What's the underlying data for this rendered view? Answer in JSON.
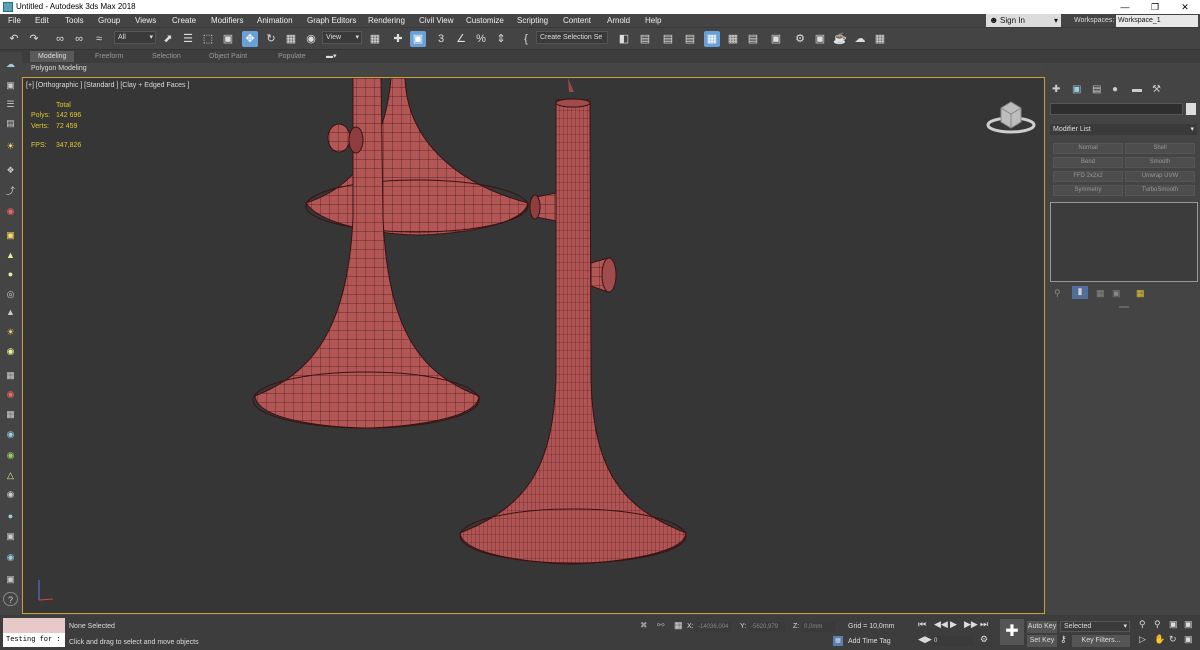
{
  "window": {
    "title": "Untitled - Autodesk 3ds Max 2018"
  },
  "menu": [
    "File",
    "Edit",
    "Tools",
    "Group",
    "Views",
    "Create",
    "Modifiers",
    "Animation",
    "Graph Editors",
    "Rendering",
    "Civil View",
    "Customize",
    "Scripting",
    "Content",
    "Arnold",
    "Help"
  ],
  "account": {
    "signin": "Sign In",
    "workspaces_label": "Workspaces:",
    "workspace": "Workspace_1"
  },
  "toolbar": {
    "filter": "All",
    "ref_coord": "View",
    "selection_set": "Create Selection Se"
  },
  "ribbon": {
    "tabs": [
      "Modeling",
      "Freeform",
      "Selection",
      "Object Paint",
      "Populate"
    ],
    "active": "Modeling",
    "panel": "Polygon Modeling"
  },
  "viewport": {
    "label": "[+] [Orthographic ] [Standard ] [Clay + Edged Faces ]",
    "stats": {
      "total_label": "Total",
      "polys_label": "Polys:",
      "polys": "142 696",
      "verts_label": "Verts:",
      "verts": "72 459",
      "fps_label": "FPS:",
      "fps": "347,826"
    },
    "object_color": "#b25656"
  },
  "command_panel": {
    "modifier_list": "Modifier List",
    "modifiers": [
      "Normal",
      "Shell",
      "Bend",
      "Smooth",
      "FFD 2x2x2",
      "Unwrap UVW",
      "Symmetry",
      "TurboSmooth"
    ]
  },
  "status": {
    "maxscript_output": "Testing for :",
    "selection": "None Selected",
    "prompt": "Click and drag to select and move objects",
    "x_label": "X:",
    "x": "-14036,004",
    "y_label": "Y:",
    "y": "-5620,979",
    "z_label": "Z:",
    "z": "0,0mm",
    "grid": "Grid = 10,0mm",
    "add_time_tag": "Add Time Tag",
    "frame": "0",
    "auto_key": "Auto Key",
    "set_key": "Set Key",
    "key_mode": "Selected",
    "key_filters": "Key Filters..."
  }
}
